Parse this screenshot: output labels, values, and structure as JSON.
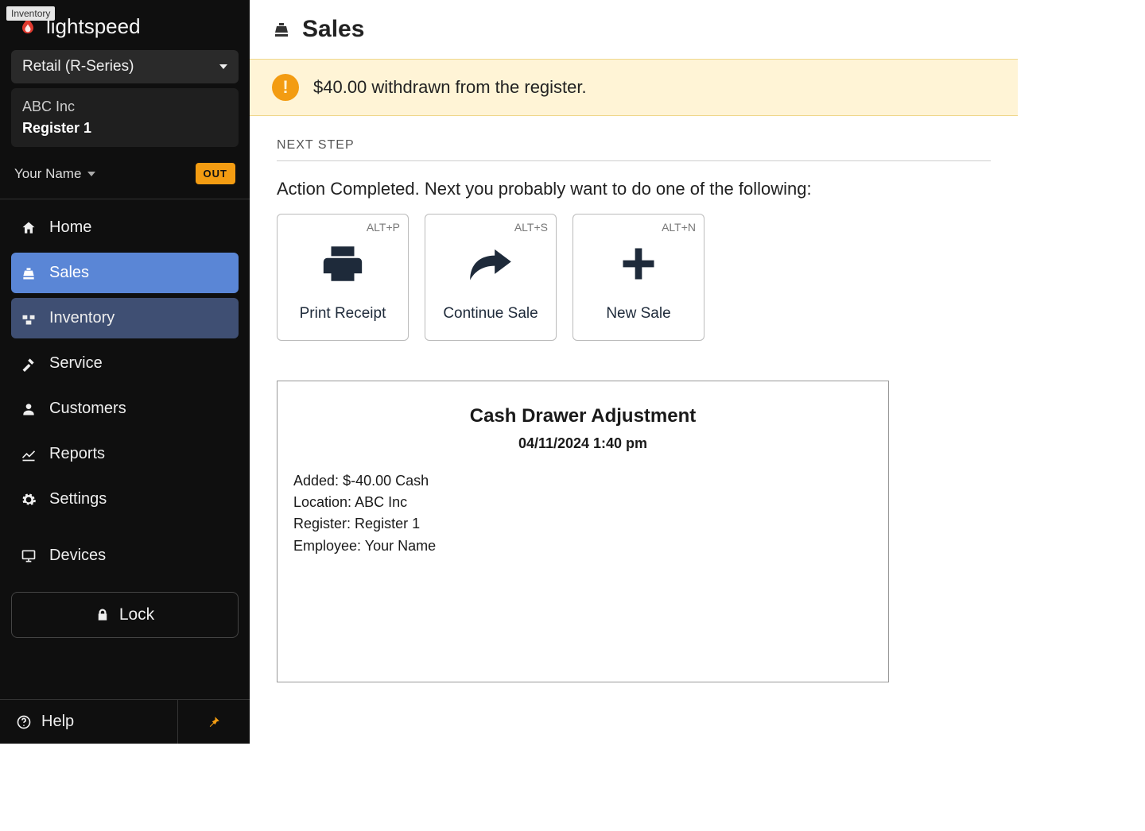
{
  "tooltip": "Inventory",
  "brand": "lightspeed",
  "selector": {
    "label": "Retail (R-Series)"
  },
  "store": {
    "name": "ABC Inc",
    "register": "Register 1"
  },
  "user": {
    "name": "Your Name",
    "badge": "OUT"
  },
  "nav": {
    "home": "Home",
    "sales": "Sales",
    "inventory": "Inventory",
    "service": "Service",
    "customers": "Customers",
    "reports": "Reports",
    "settings": "Settings",
    "devices": "Devices",
    "lock": "Lock",
    "help": "Help"
  },
  "page": {
    "title": "Sales",
    "alert": "$40.00 withdrawn from the register.",
    "section_label": "NEXT STEP",
    "action_desc": "Action Completed. Next you probably want to do one of the following:",
    "actions": {
      "print": {
        "label": "Print Receipt",
        "shortcut": "ALT+P"
      },
      "continue": {
        "label": "Continue Sale",
        "shortcut": "ALT+S"
      },
      "new": {
        "label": "New Sale",
        "shortcut": "ALT+N"
      }
    },
    "receipt": {
      "title": "Cash Drawer Adjustment",
      "datetime": "04/11/2024 1:40 pm",
      "added_label": "Added:",
      "added_value": "$-40.00 Cash",
      "location_label": "Location:",
      "location_value": "ABC Inc",
      "register_label": "Register:",
      "register_value": "Register 1",
      "employee_label": "Employee:",
      "employee_value": "Your Name"
    }
  }
}
